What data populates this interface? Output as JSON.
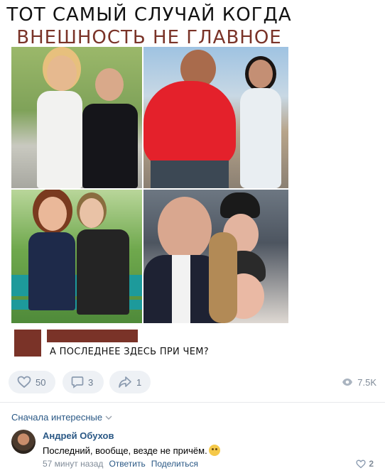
{
  "meme": {
    "title_line1": "ТОТ САМЫЙ СЛУЧАЙ КОГДА",
    "title_line2": "ВНЕШНОСТЬ НЕ ГЛАВНОЕ",
    "title_color": "#7a3328",
    "comment_text": "А ПОСЛЕДНЕЕ ЗДЕСЬ ПРИ ЧЕМ?"
  },
  "post_actions": {
    "likes": "50",
    "comments": "3",
    "shares": "1",
    "views": "7.5K",
    "icons": [
      "heart-icon",
      "comment-icon",
      "share-icon",
      "eye-icon"
    ]
  },
  "comments_section": {
    "sort_label": "Сначала интересные",
    "items": [
      {
        "author": "Андрей Обухов",
        "text": "Последний, вообще, везде не причём.",
        "time": "57 минут назад",
        "reply_label": "Ответить",
        "share_label": "Поделиться",
        "likes": "2"
      }
    ]
  },
  "colors": {
    "link": "#2a5885",
    "muted": "#818c99",
    "button_bg": "#eef1f5"
  }
}
